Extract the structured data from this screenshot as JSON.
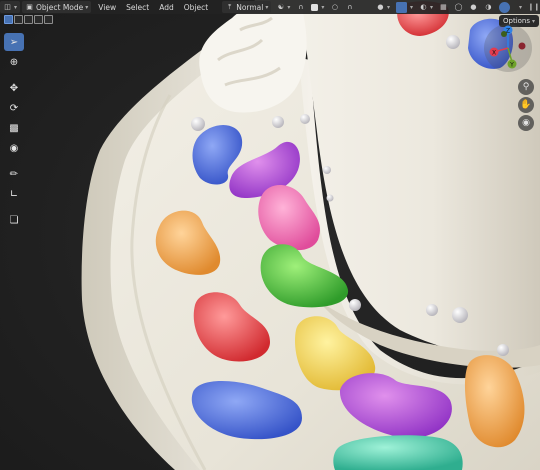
{
  "header": {
    "editor_type_icon": "cube-editor-icon",
    "mode": "Object Mode",
    "menus": [
      "View",
      "Select",
      "Add",
      "Object"
    ],
    "transform_orientation": "Normal"
  },
  "options_label": "Options",
  "toolbar": {
    "tools": [
      "select-box",
      "cursor",
      "move",
      "rotate",
      "scale",
      "transform",
      "annotate",
      "measure",
      "add-cube"
    ]
  },
  "gizmo": {
    "axes": [
      "X",
      "Y",
      "Z"
    ],
    "colors": {
      "x": "#e23c4f",
      "y": "#6fa32a",
      "z": "#2e82e8"
    }
  },
  "theme": {
    "accent": "#4772b3",
    "header_bg": "#232323"
  }
}
